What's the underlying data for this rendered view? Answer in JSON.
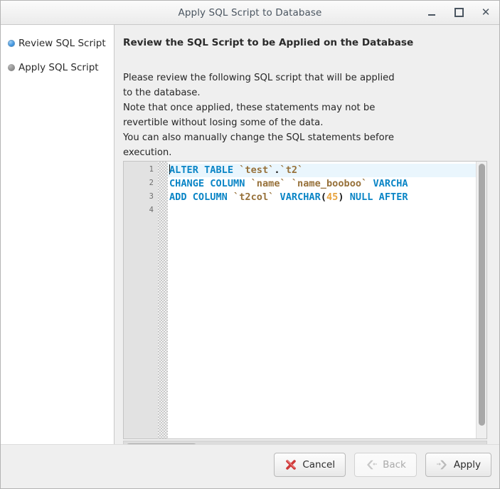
{
  "window": {
    "title": "Apply SQL Script to Database",
    "controls": [
      {
        "name": "minimize",
        "glyph": "minimize-icon"
      },
      {
        "name": "maximize",
        "glyph": "maximize-icon"
      },
      {
        "name": "close",
        "glyph": "close-icon",
        "label": "✕"
      }
    ]
  },
  "sidebar": {
    "items": [
      {
        "label": "Review SQL Script",
        "state": "active"
      },
      {
        "label": "Apply SQL Script",
        "state": "inactive"
      }
    ]
  },
  "main": {
    "heading": "Review the SQL Script to be Applied on the Database",
    "description": [
      "Please review the following SQL script that will be applied",
      "to the database.",
      "Note that once applied, these statements may not be",
      "revertible without losing some of the data.",
      "You can also manually change the SQL statements before",
      "execution."
    ]
  },
  "editor": {
    "line_numbers": [
      "1",
      "2",
      "3",
      "4"
    ],
    "lines": [
      {
        "number": "1",
        "current": true,
        "text": "ALTER TABLE `test`.`t2`",
        "tokens": [
          {
            "t": "ALTER TABLE ",
            "c": "kw"
          },
          {
            "t": "`test`",
            "c": "ident"
          },
          {
            "t": ".",
            "c": "punct"
          },
          {
            "t": "`t2`",
            "c": "ident"
          }
        ]
      },
      {
        "number": "2",
        "current": false,
        "text": "CHANGE COLUMN `name` `name_booboo` VARCHAR",
        "tokens": [
          {
            "t": "CHANGE COLUMN ",
            "c": "kw"
          },
          {
            "t": "`name` ",
            "c": "ident"
          },
          {
            "t": "`name_booboo` ",
            "c": "ident"
          },
          {
            "t": "VARCHA",
            "c": "kw"
          }
        ]
      },
      {
        "number": "3",
        "current": false,
        "text": "ADD COLUMN `t2col` VARCHAR(45) NULL AFTER",
        "tokens": [
          {
            "t": "ADD COLUMN ",
            "c": "kw"
          },
          {
            "t": "`t2col` ",
            "c": "ident"
          },
          {
            "t": "VARCHAR",
            "c": "kw"
          },
          {
            "t": "(",
            "c": "punct"
          },
          {
            "t": "45",
            "c": "num"
          },
          {
            "t": ")",
            "c": "punct"
          },
          {
            "t": " NULL AFTER",
            "c": "kw"
          }
        ]
      },
      {
        "number": "4",
        "current": false,
        "text": "",
        "tokens": []
      }
    ],
    "colors": {
      "keyword": "#0a85c6",
      "identifier": "#97713a",
      "number": "#e8a33d",
      "current_line_bg": "#eaf6fd",
      "gutter_bg": "#e2e2e2"
    }
  },
  "footer": {
    "buttons": [
      {
        "label": "Cancel",
        "icon": "red-x-icon",
        "enabled": true
      },
      {
        "label": "Back",
        "icon": "back-chevron-icon",
        "enabled": false
      },
      {
        "label": "Apply",
        "icon": "forward-chevron-icon",
        "enabled": true
      }
    ]
  }
}
